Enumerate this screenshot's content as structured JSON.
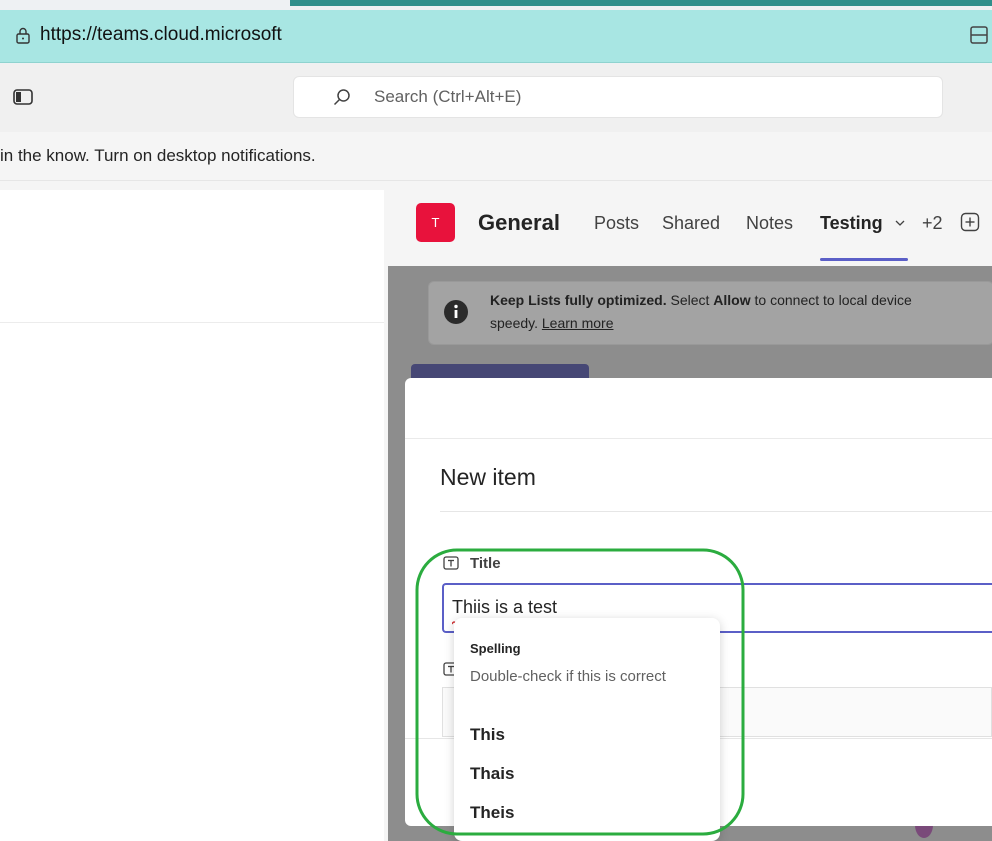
{
  "browser": {
    "url_prefix": "https://",
    "url_host": "teams.cloud.microsoft"
  },
  "topbar": {
    "search_placeholder": "Search (Ctrl+Alt+E)"
  },
  "notification": {
    "text": "in the know. Turn on desktop notifications."
  },
  "channel": {
    "team_initial": "T",
    "name": "General",
    "tabs": [
      {
        "label": "Posts"
      },
      {
        "label": "Shared"
      },
      {
        "label": "Notes"
      },
      {
        "label": "Testing"
      }
    ],
    "more_tabs": "+2"
  },
  "info_banner": {
    "bold_part": "Keep Lists fully optimized.",
    "text_part1": " Select ",
    "allow": "Allow",
    "text_part2": " to connect to local device",
    "line2_prefix": "speedy. ",
    "learn_more": "Learn more"
  },
  "dialog": {
    "title": "New item",
    "title_field_label": "Title",
    "title_field_value": "Thiis is a test"
  },
  "spelling_popup": {
    "header": "Spelling",
    "description": "Double-check if this is correct",
    "suggestions": [
      "This",
      "Thais",
      "Theis"
    ]
  },
  "colors": {
    "address_bar": "#a8e6e3",
    "accent": "#5b5fc7",
    "team_avatar": "#e8123c",
    "annotation": "#2bac3f"
  }
}
